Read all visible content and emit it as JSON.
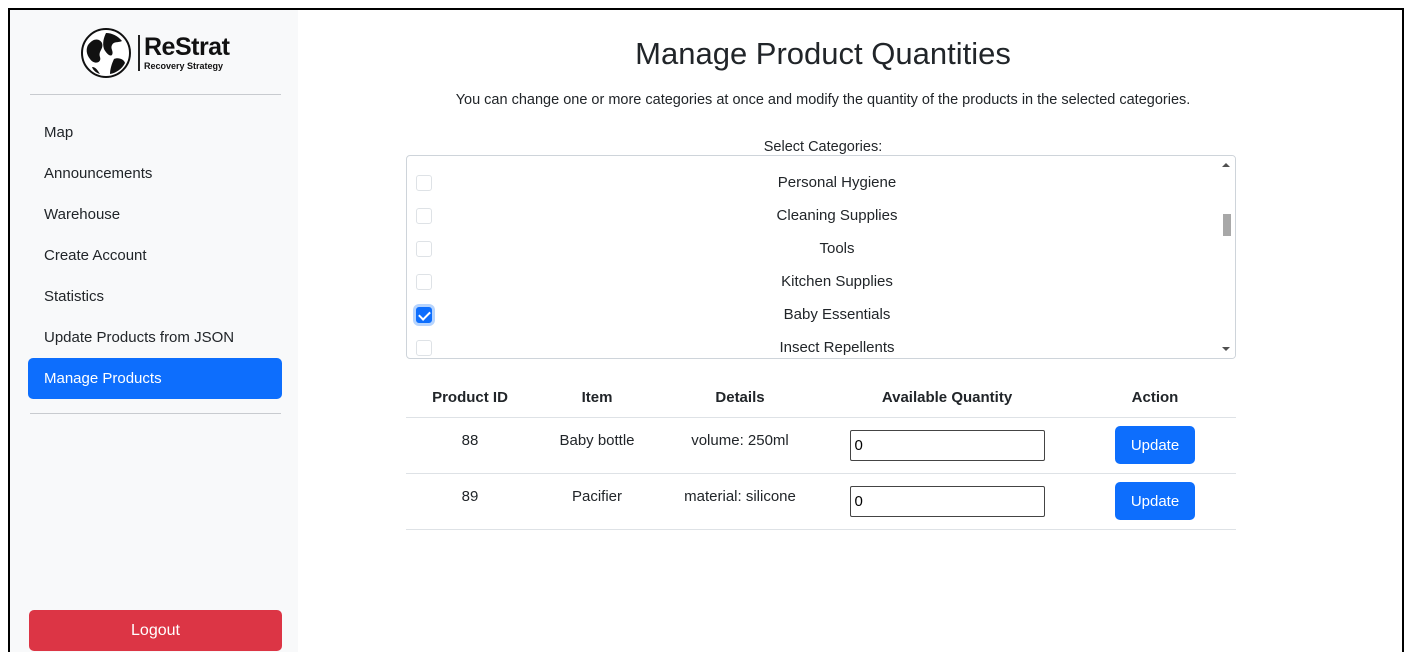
{
  "brand": {
    "name": "ReStrat",
    "subtitle": "Recovery Strategy"
  },
  "sidebar": {
    "items": [
      {
        "label": "Map",
        "active": false
      },
      {
        "label": "Announcements",
        "active": false
      },
      {
        "label": "Warehouse",
        "active": false
      },
      {
        "label": "Create Account",
        "active": false
      },
      {
        "label": "Statistics",
        "active": false
      },
      {
        "label": "Update Products from JSON",
        "active": false
      },
      {
        "label": "Manage Products",
        "active": true
      }
    ],
    "logout_label": "Logout"
  },
  "main": {
    "title": "Manage Product Quantities",
    "description": "You can change one or more categories at once and modify the quantity of the products in the selected categories.",
    "select_label": "Select Categories:",
    "categories": [
      {
        "label": "Personal Hygiene",
        "checked": false
      },
      {
        "label": "Cleaning Supplies",
        "checked": false
      },
      {
        "label": "Tools",
        "checked": false
      },
      {
        "label": "Kitchen Supplies",
        "checked": false
      },
      {
        "label": "Baby Essentials",
        "checked": true
      },
      {
        "label": "Insect Repellents",
        "checked": false
      }
    ],
    "table": {
      "headers": [
        "Product ID",
        "Item",
        "Details",
        "Available Quantity",
        "Action"
      ],
      "rows": [
        {
          "id": "88",
          "item": "Baby bottle",
          "details": "volume: 250ml",
          "quantity": "0",
          "action": "Update"
        },
        {
          "id": "89",
          "item": "Pacifier",
          "details": "material: silicone",
          "quantity": "0",
          "action": "Update"
        }
      ]
    }
  },
  "colors": {
    "primary": "#0d6efd",
    "danger": "#dc3545",
    "sidebar_bg": "#f8f9fa"
  }
}
